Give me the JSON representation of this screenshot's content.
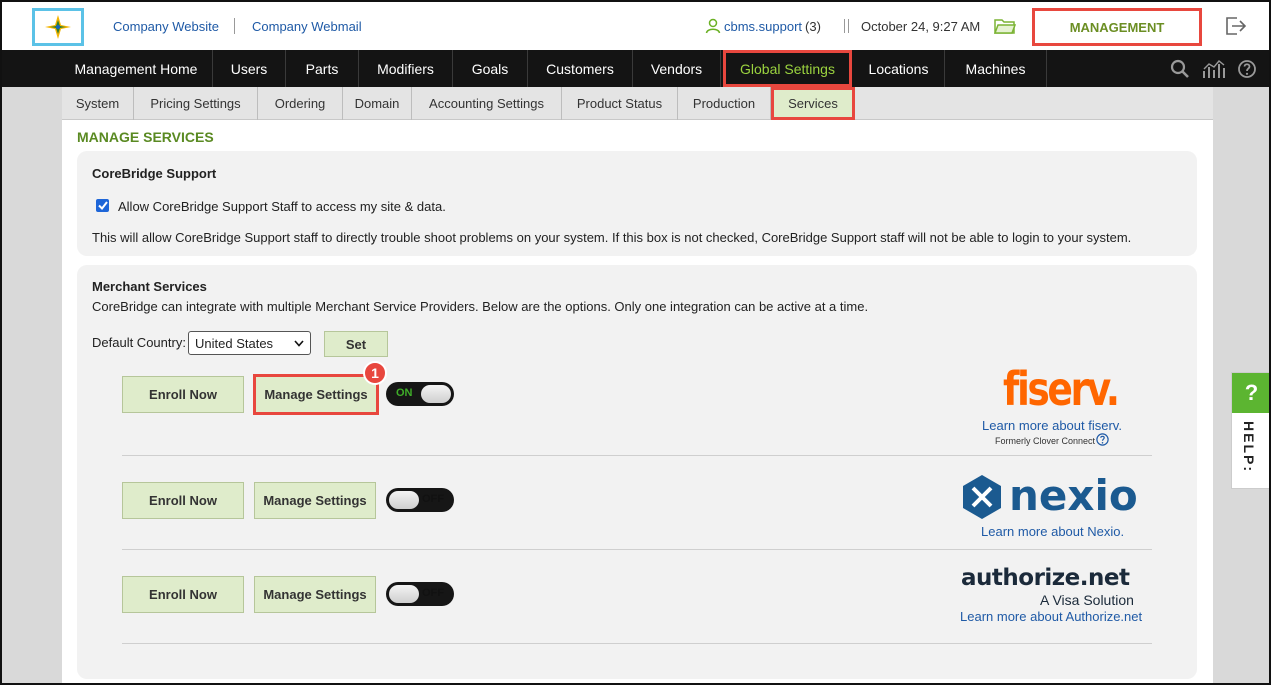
{
  "topbar": {
    "links": [
      "Company Website",
      "Company Webmail"
    ],
    "user_name": "cbms.support",
    "user_count": "(3)",
    "datetime": "October 24, 9:27 AM",
    "management_label": "MANAGEMENT"
  },
  "main_nav": [
    "Management Home",
    "Users",
    "Parts",
    "Modifiers",
    "Goals",
    "Customers",
    "Vendors",
    "Global Settings",
    "Locations",
    "Machines"
  ],
  "sub_nav": [
    "System",
    "Pricing Settings",
    "Ordering",
    "Domain",
    "Accounting Settings",
    "Product Status",
    "Production",
    "Services"
  ],
  "page_title": "MANAGE SERVICES",
  "support": {
    "heading": "CoreBridge Support",
    "checkbox_label": "Allow CoreBridge Support Staff to access my site & data.",
    "checked": true,
    "description": "This will allow CoreBridge Support staff to directly trouble shoot problems on your system. If this box is not checked, CoreBridge Support staff will not be able to login to your system."
  },
  "merchant": {
    "heading": "Merchant Services",
    "description": "CoreBridge can integrate with multiple Merchant Service Providers. Below are the options. Only one integration can be active at a time.",
    "country_label": "Default Country:",
    "country_value": "United States",
    "set_label": "Set",
    "enroll_label": "Enroll Now",
    "manage_label": "Manage Settings",
    "step_badge": "1",
    "providers": [
      {
        "logo": "fiserv.",
        "toggle": "ON",
        "link": "Learn more about fiserv.",
        "note": "Formerly Clover Connect"
      },
      {
        "logo": "nexio",
        "toggle": "OFF",
        "link": "Learn more about Nexio."
      },
      {
        "logo": "authorize.net",
        "tagline": "A Visa Solution",
        "toggle": "OFF",
        "link": "Learn more about Authorize.net"
      }
    ]
  },
  "help": {
    "q": "?",
    "label": "HELP:"
  },
  "colors": {
    "accent_green": "#5a8a22",
    "highlight_red": "#e8473e",
    "button_bg": "#dfeccb",
    "fiserv_orange": "#ff6600",
    "nexio_blue": "#1b5a90"
  }
}
